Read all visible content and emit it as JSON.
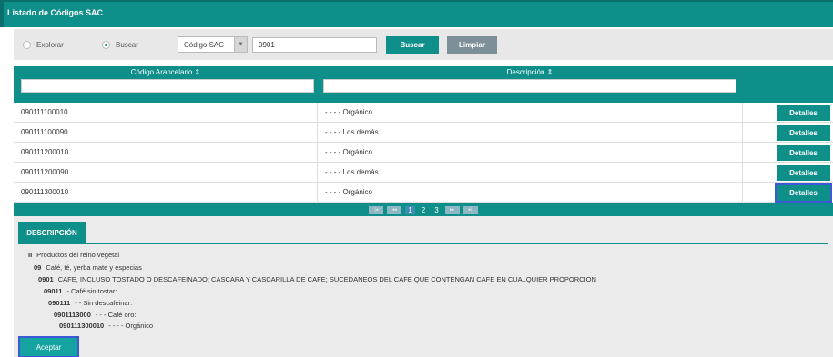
{
  "window": {
    "title": "Listado de Códigos SAC"
  },
  "search": {
    "radio_explore": "Explorar",
    "radio_search": "Buscar",
    "selected_mode": "Buscar",
    "combo_value": "Código SAC",
    "input_value": "0901",
    "search_button": "Buscar",
    "clear_button": "Limpiar"
  },
  "grid": {
    "columns": [
      "Código Arancelario ⇕",
      "Descripción ⇕"
    ],
    "detail_label": "Detalles",
    "rows": [
      {
        "code": "090111100010",
        "description": "- - - - Orgánico",
        "action": "Detalles"
      },
      {
        "code": "090111100090",
        "description": "- - - - Los demás",
        "action": "Detalles"
      },
      {
        "code": "090111200010",
        "description": "- - - - Orgánico",
        "action": "Detalles"
      },
      {
        "code": "090111200090",
        "description": "- - - - Los demás",
        "action": "Detalles"
      },
      {
        "code": "090111300010",
        "description": "- - - - Orgánico",
        "action": "Detalles"
      }
    ],
    "selected_row": 4,
    "pagination": {
      "first": "|◂",
      "prev": "◂◂",
      "pages": [
        "1",
        "2",
        "3"
      ],
      "current": "1",
      "next": "▸▸",
      "last": "▸|"
    }
  },
  "detail": {
    "tab_label": "DESCRIPCIÓN",
    "lines": [
      {
        "code": "II",
        "text": "Productos del reino vegetal"
      },
      {
        "code": "09",
        "text": "Café, té, yerba mate y especias"
      },
      {
        "code": "0901",
        "text": "CAFE, INCLUSO TOSTADO O DESCAFEINADO; CASCARA Y CASCARILLA DE CAFE; SUCEDANEOS DEL CAFE QUE CONTENGAN CAFE EN CUALQUIER PROPORCION"
      },
      {
        "code": "09011",
        "text": "- Café sin tostar:"
      },
      {
        "code": "090111",
        "text": "- - Sin descafeinar:"
      },
      {
        "code": "0901113000",
        "text": "- - - Café oro:"
      },
      {
        "code": "090111300010",
        "text": "- - - - Orgánico"
      }
    ],
    "accept_button": "Aceptar"
  },
  "colors": {
    "accent": "#0f8f8a",
    "selection": "#3c5ad6",
    "clear": "#7d8f99"
  }
}
